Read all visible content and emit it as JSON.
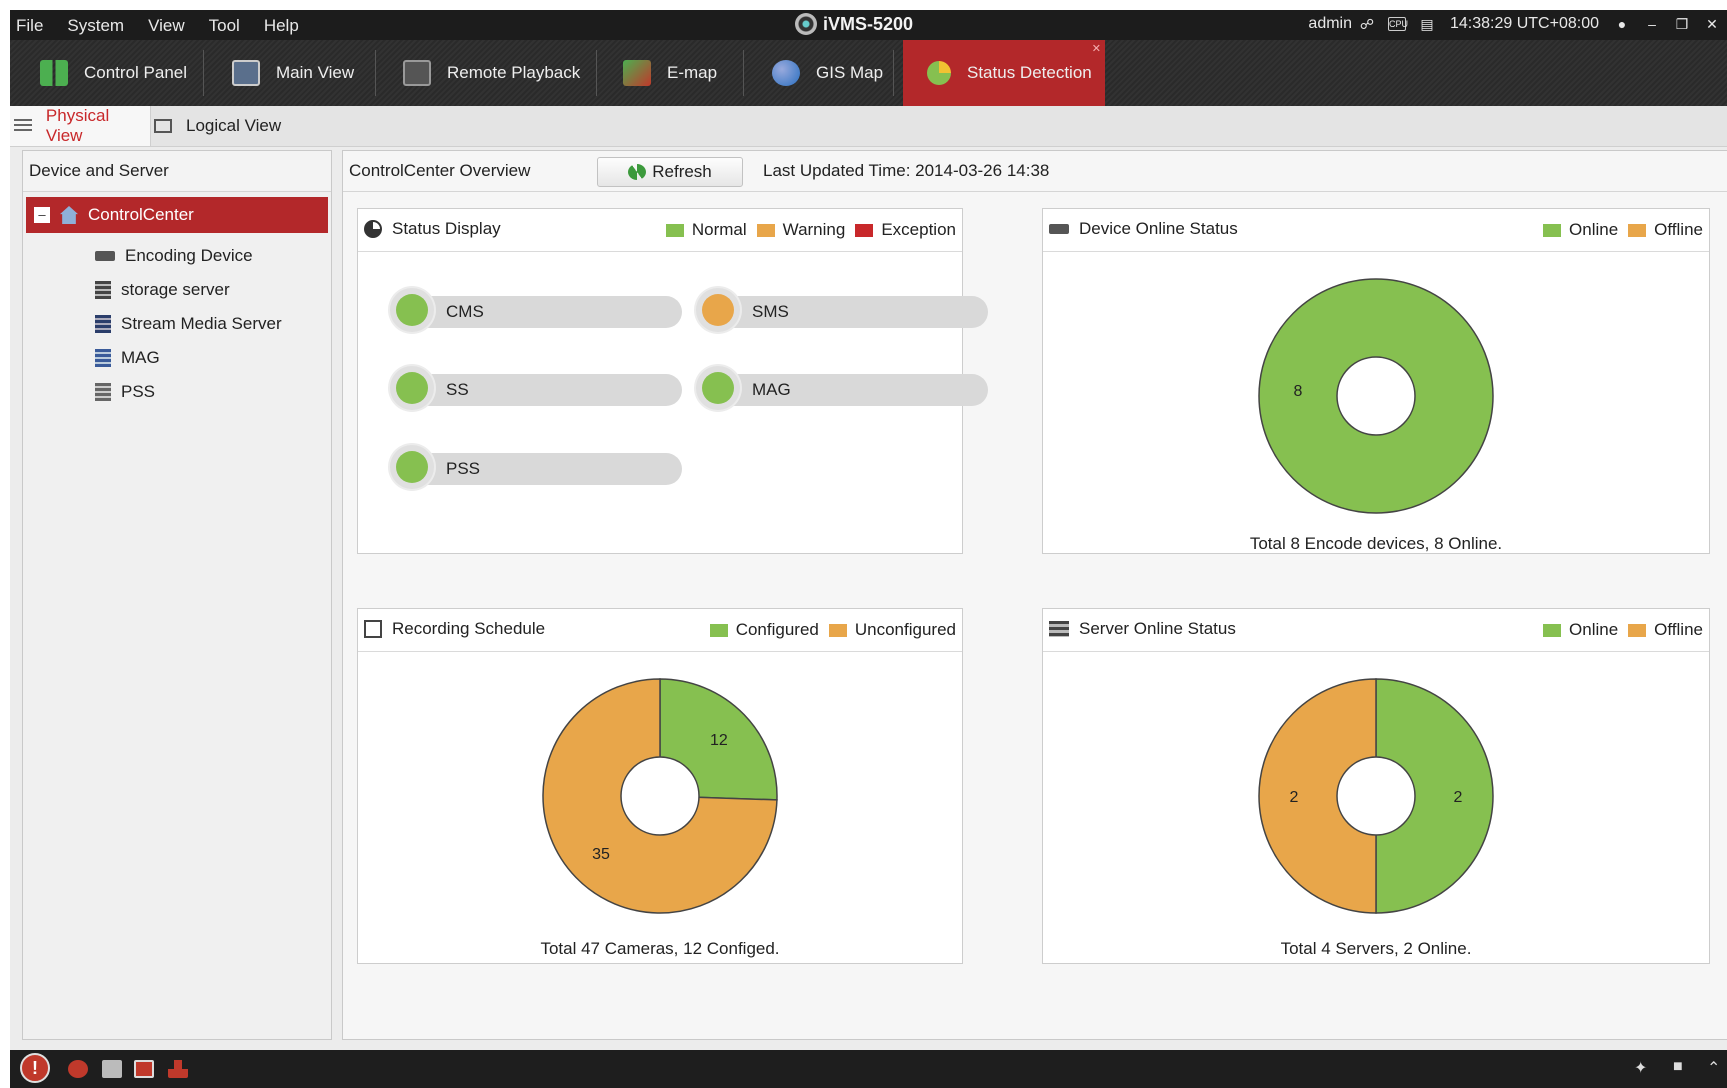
{
  "menu": [
    "File",
    "System",
    "View",
    "Tool",
    "Help"
  ],
  "app_title": "iVMS-5200",
  "user": "admin",
  "clock": "14:38:29 UTC+08:00",
  "cpu_label": "CPU",
  "modules": [
    {
      "label": "Control Panel",
      "icon": "control-panel-icon"
    },
    {
      "label": "Main View",
      "icon": "main-view-icon"
    },
    {
      "label": "Remote Playback",
      "icon": "remote-playback-icon"
    },
    {
      "label": "E-map",
      "icon": "emap-icon"
    },
    {
      "label": "GIS Map",
      "icon": "gis-map-icon"
    },
    {
      "label": "Status Detection",
      "icon": "status-detection-icon",
      "active": true
    }
  ],
  "view_tabs": [
    {
      "label": "Physical View",
      "active": true
    },
    {
      "label": "Logical View"
    }
  ],
  "left_panel": {
    "title": "Device and Server",
    "root": "ControlCenter",
    "items": [
      "Encoding Device",
      "storage server",
      "Stream Media Server",
      "MAG",
      "PSS"
    ]
  },
  "overview": {
    "title": "ControlCenter Overview",
    "refresh_label": "Refresh",
    "last_updated": "Last Updated Time: 2014-03-26 14:38"
  },
  "colors": {
    "normal": "#86c050",
    "warning": "#e8a64a",
    "exception": "#c8282a",
    "accent": "#b3282a"
  },
  "status_display": {
    "title": "Status Display",
    "legend": [
      "Normal",
      "Warning",
      "Exception"
    ],
    "services": [
      {
        "name": "CMS",
        "status": "normal"
      },
      {
        "name": "SMS",
        "status": "warning"
      },
      {
        "name": "SS",
        "status": "normal"
      },
      {
        "name": "MAG",
        "status": "normal"
      },
      {
        "name": "PSS",
        "status": "normal"
      }
    ]
  },
  "device_online": {
    "title": "Device Online Status",
    "legend": [
      "Online",
      "Offline"
    ],
    "caption": "Total 8 Encode devices, 8 Online."
  },
  "recording": {
    "title": "Recording Schedule",
    "legend": [
      "Configured",
      "Unconfigured"
    ],
    "caption": "Total 47 Cameras, 12 Configed."
  },
  "server_online": {
    "title": "Server Online Status",
    "legend": [
      "Online",
      "Offline"
    ],
    "caption": "Total 4 Servers, 2 Online."
  },
  "chart_data": [
    {
      "type": "pie",
      "title": "Device Online Status",
      "categories": [
        "Online",
        "Offline"
      ],
      "values": [
        8,
        0
      ],
      "labels": [
        "8",
        ""
      ]
    },
    {
      "type": "pie",
      "title": "Recording Schedule",
      "categories": [
        "Configured",
        "Unconfigured"
      ],
      "values": [
        12,
        35
      ],
      "labels": [
        "12",
        "35"
      ]
    },
    {
      "type": "pie",
      "title": "Server Online Status",
      "categories": [
        "Online",
        "Offline"
      ],
      "values": [
        2,
        2
      ],
      "labels": [
        "2",
        "2"
      ]
    }
  ]
}
